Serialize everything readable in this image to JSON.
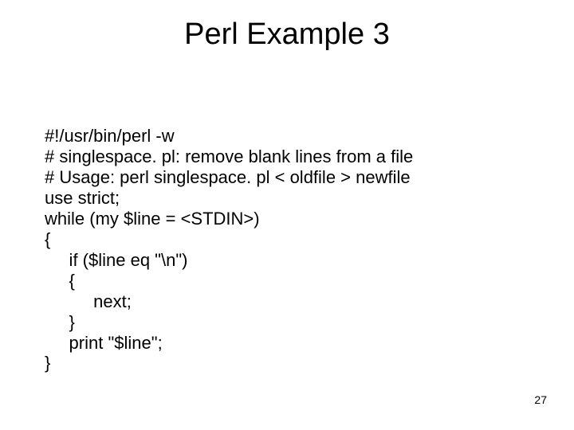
{
  "title": "Perl Example 3",
  "code": "#!/usr/bin/perl -w\n# singlespace. pl: remove blank lines from a file\n# Usage: perl singlespace. pl < oldfile > newfile\nuse strict;\nwhile (my $line = <STDIN>)\n{\n     if ($line eq \"\\n\")\n     {\n          next;\n     }\n     print \"$line\";\n}",
  "page_number": "27"
}
